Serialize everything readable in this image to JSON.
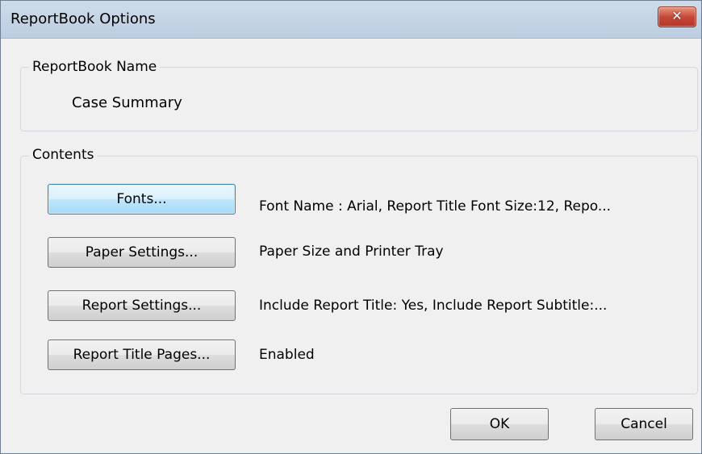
{
  "window": {
    "title": "ReportBook Options",
    "close_label": "✕"
  },
  "name_group": {
    "legend": "ReportBook Name",
    "value": "Case Summary"
  },
  "contents_group": {
    "legend": "Contents",
    "rows": [
      {
        "button": "Fonts...",
        "description": "Font Name : Arial, Report Title Font Size:12, Repo..."
      },
      {
        "button": "Paper Settings...",
        "description": "Paper Size and Printer Tray"
      },
      {
        "button": "Report Settings...",
        "description": "Include Report Title: Yes, Include Report Subtitle:..."
      },
      {
        "button": "Report Title Pages...",
        "description": "Enabled"
      }
    ]
  },
  "footer": {
    "ok_label": "OK",
    "cancel_label": "Cancel"
  },
  "colors": {
    "titlebar": "#c4d4e6",
    "close_button": "#c4493a",
    "focused_button": "#bee6fd"
  }
}
